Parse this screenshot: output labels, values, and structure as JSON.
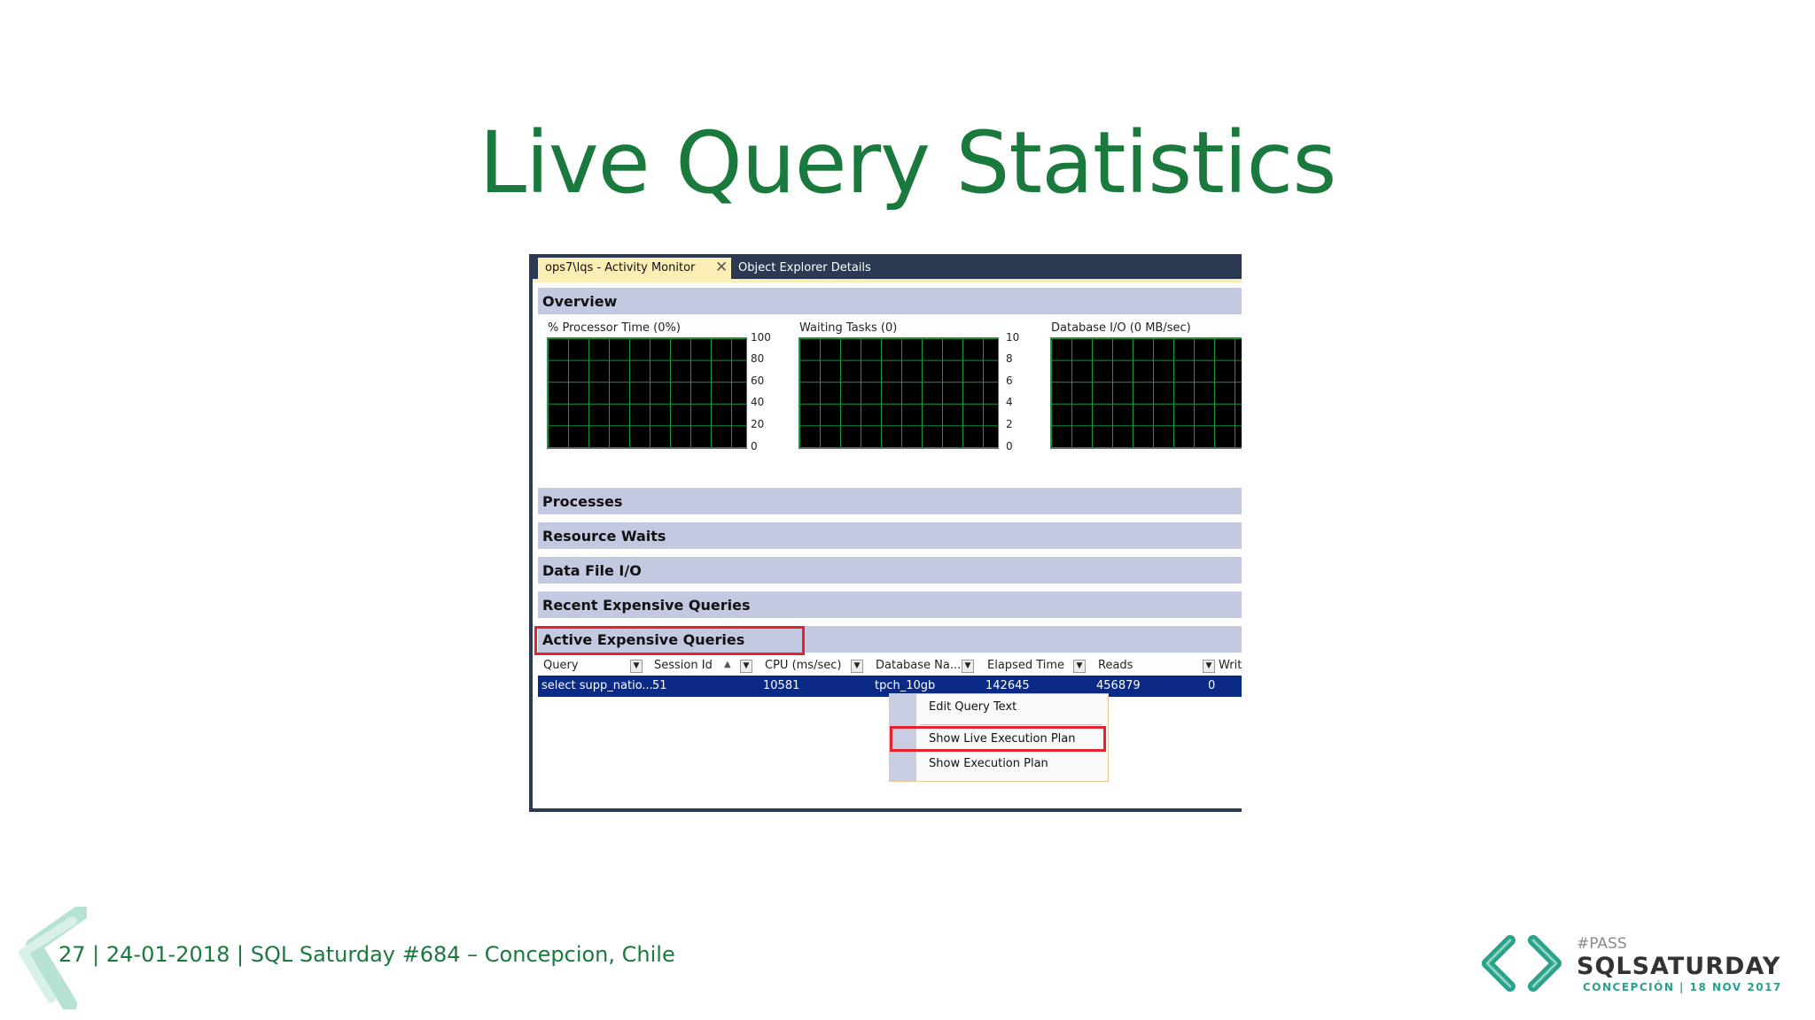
{
  "slide": {
    "title": "Live Query Statistics",
    "footer": "27  |  24-01-2018 |    SQL Saturday #684 – Concepcion, Chile"
  },
  "logo": {
    "pass": "#PASS",
    "name": "SQLSATURDAY",
    "subtitle": "CONCEPCIÓN | 18 NOV 2017"
  },
  "tabs": {
    "active": "ops7\\lqs - Activity Monitor",
    "inactive": "Object Explorer Details"
  },
  "overview": {
    "label": "Overview",
    "graphs": [
      {
        "label": "% Processor Time (0%)",
        "axis": [
          "100",
          "80",
          "60",
          "40",
          "20",
          "0"
        ]
      },
      {
        "label": "Waiting Tasks (0)",
        "axis": [
          "10",
          "8",
          "6",
          "4",
          "2",
          "0"
        ]
      },
      {
        "label": "Database I/O (0 MB/sec)",
        "axis": []
      }
    ]
  },
  "sections": {
    "processes": "Processes",
    "resource_waits": "Resource Waits",
    "data_file_io": "Data File I/O",
    "recent_expensive": "Recent Expensive Queries",
    "active_expensive": "Active Expensive Queries"
  },
  "grid": {
    "columns": [
      "Query",
      "Session Id",
      "CPU (ms/sec)",
      "Database Na...",
      "Elapsed Time",
      "Reads",
      "Writes"
    ],
    "row": [
      "select supp_natio...",
      "51",
      "10581",
      "tpch_10gb",
      "142645",
      "456879",
      "0"
    ]
  },
  "context_menu": {
    "items": [
      "Edit Query Text",
      "Show Live Execution Plan",
      "Show Execution Plan"
    ]
  },
  "colors": {
    "title_green": "#1a7a3e",
    "highlight_red": "#e32330",
    "selected_row": "#0b2a85"
  }
}
